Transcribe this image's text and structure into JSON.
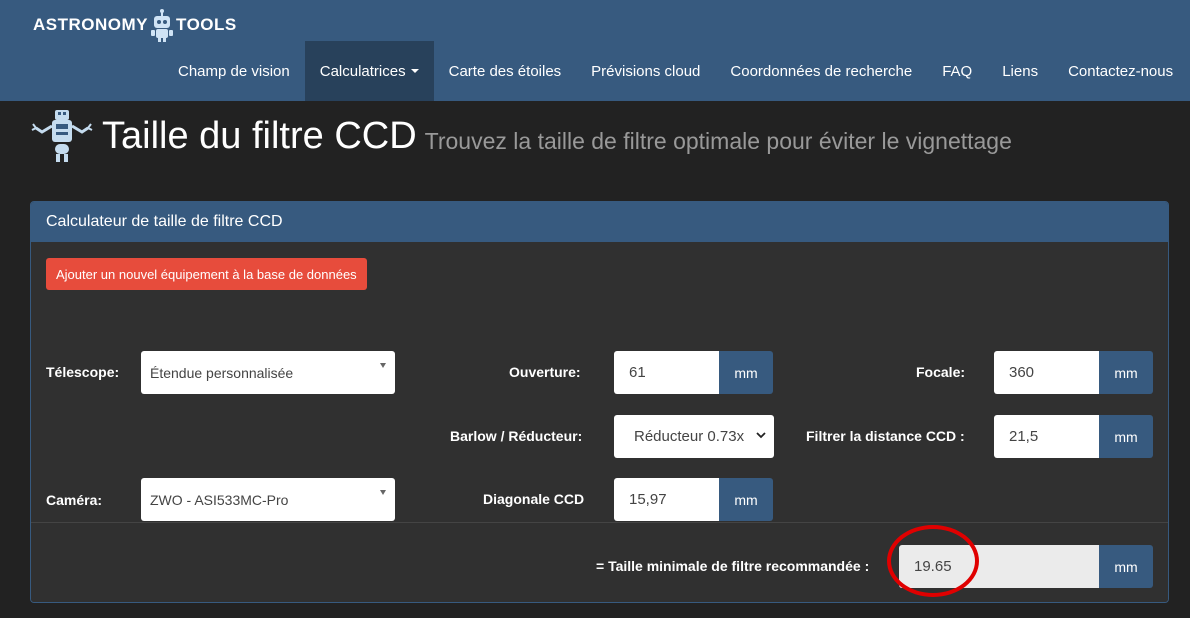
{
  "brand": {
    "left": "ASTRONOMY",
    "right": "TOOLS"
  },
  "nav": [
    {
      "label": "Champ de vision"
    },
    {
      "label": "Calculatrices"
    },
    {
      "label": "Carte des étoiles"
    },
    {
      "label": "Prévisions cloud"
    },
    {
      "label": "Coordonnées de recherche"
    },
    {
      "label": "FAQ"
    },
    {
      "label": "Liens"
    },
    {
      "label": "Contactez-nous"
    }
  ],
  "header": {
    "title": "Taille du filtre CCD",
    "subtitle": "Trouvez la taille de filtre optimale pour éviter le vignettage"
  },
  "panel": {
    "title": "Calculateur de taille de filtre CCD",
    "add_button": "Ajouter un nouvel équipement à la base de données",
    "telescope": {
      "label": "Télescope:",
      "value": "Étendue personnalisée"
    },
    "aperture": {
      "label": "Ouverture:",
      "value": "61",
      "unit": "mm"
    },
    "focal": {
      "label": "Focale:",
      "value": "360",
      "unit": "mm"
    },
    "barlow": {
      "label": "Barlow / Réducteur:",
      "value": "Réducteur 0.73x"
    },
    "filter_distance": {
      "label": "Filtrer la distance CCD :",
      "value": "21,5",
      "unit": "mm"
    },
    "camera": {
      "label": "Caméra:",
      "value": "ZWO - ASI533MC-Pro"
    },
    "diagonal": {
      "label": "Diagonale CCD",
      "value": "15,97",
      "unit": "mm"
    },
    "result": {
      "label": "= Taille minimale de filtre recommandée :",
      "value": "19.65",
      "unit": "mm"
    }
  },
  "colors": {
    "navbar": "#375a7f",
    "active_nav": "#28415b",
    "danger": "#e74c3c",
    "highlight": "#e00000",
    "background": "#222222"
  }
}
